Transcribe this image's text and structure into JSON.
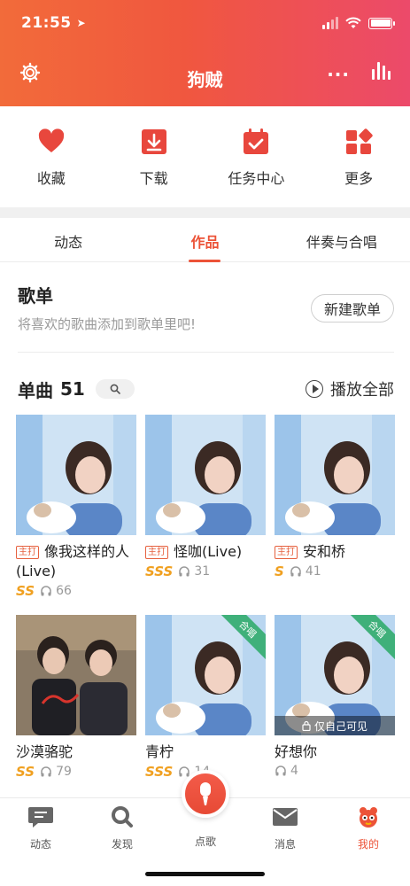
{
  "status_bar": {
    "time": "21:55"
  },
  "header": {
    "title": "狗贼",
    "more_label": "···"
  },
  "quick_actions": [
    {
      "label": "收藏",
      "icon": "heart-icon"
    },
    {
      "label": "下载",
      "icon": "download-icon"
    },
    {
      "label": "任务中心",
      "icon": "calendar-check-icon"
    },
    {
      "label": "更多",
      "icon": "apps-grid-icon"
    }
  ],
  "tabs": [
    "动态",
    "作品",
    "伴奏与合唱"
  ],
  "active_tab": 1,
  "playlist": {
    "title": "歌单",
    "subtitle": "将喜欢的歌曲添加到歌单里吧!",
    "new_button": "新建歌单"
  },
  "singles": {
    "title": "单曲",
    "count": "51",
    "play_all": "播放全部"
  },
  "songs": [
    {
      "tag": "主打",
      "name": "像我这样的人(Live)",
      "grade": "SS",
      "plays": "66",
      "corner_badge": "",
      "private": ""
    },
    {
      "tag": "主打",
      "name": "怪咖(Live)",
      "grade": "SSS",
      "plays": "31",
      "corner_badge": "",
      "private": ""
    },
    {
      "tag": "主打",
      "name": "安和桥",
      "grade": "S",
      "plays": "41",
      "corner_badge": "",
      "private": ""
    },
    {
      "tag": "",
      "name": "沙漠骆驼",
      "grade": "SS",
      "plays": "79",
      "corner_badge": "",
      "private": ""
    },
    {
      "tag": "",
      "name": "青柠",
      "grade": "SSS",
      "plays": "14",
      "corner_badge": "合唱",
      "private": ""
    },
    {
      "tag": "",
      "name": "好想你",
      "grade": "",
      "plays": "4",
      "corner_badge": "合唱",
      "private": "仅自己可见"
    }
  ],
  "tabbar": [
    {
      "label": "动态",
      "icon": "message-icon"
    },
    {
      "label": "发现",
      "icon": "search-icon"
    },
    {
      "label": "点歌",
      "icon": "microphone-icon"
    },
    {
      "label": "消息",
      "icon": "mail-icon"
    },
    {
      "label": "我的",
      "icon": "profile-mascot-icon"
    }
  ],
  "tabbar_active": 4,
  "colors": {
    "accent": "#ec5338",
    "grade": "#f0a020",
    "chorus": "#3fb07a"
  }
}
